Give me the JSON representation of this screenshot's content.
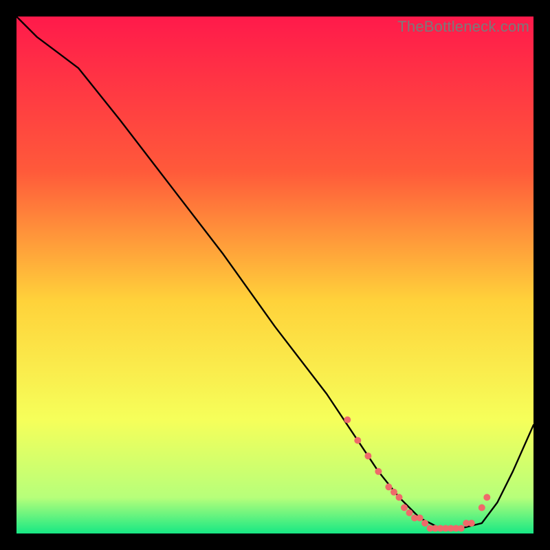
{
  "watermark": "TheBottleneck.com",
  "chart_data": {
    "type": "line",
    "title": "",
    "xlabel": "",
    "ylabel": "",
    "xlim": [
      0,
      100
    ],
    "ylim": [
      0,
      100
    ],
    "grid": false,
    "legend": false,
    "gradient_stops": [
      {
        "offset": 0,
        "color": "#ff1a4b"
      },
      {
        "offset": 0.3,
        "color": "#ff5a3a"
      },
      {
        "offset": 0.55,
        "color": "#ffd23a"
      },
      {
        "offset": 0.78,
        "color": "#f6ff5a"
      },
      {
        "offset": 0.93,
        "color": "#b7ff7a"
      },
      {
        "offset": 1.0,
        "color": "#17e884"
      }
    ],
    "series": [
      {
        "name": "bottleneck-curve",
        "x": [
          0,
          4,
          8,
          12,
          20,
          30,
          40,
          50,
          60,
          66,
          70,
          74,
          78,
          82,
          86,
          90,
          93,
          96,
          100
        ],
        "y": [
          100,
          96,
          93,
          90,
          80,
          67,
          54,
          40,
          27,
          18,
          12,
          7,
          3,
          1,
          1,
          2,
          6,
          12,
          21
        ]
      }
    ],
    "markers": {
      "name": "highlight-dots",
      "color": "#ef6a6a",
      "radius": 5,
      "x": [
        64,
        66,
        68,
        70,
        72,
        73,
        74,
        75,
        76,
        77,
        78,
        79,
        80,
        81,
        82,
        83,
        84,
        85,
        86,
        87,
        88,
        90,
        91
      ],
      "y": [
        22,
        18,
        15,
        12,
        9,
        8,
        7,
        5,
        4,
        3,
        3,
        2,
        1,
        1,
        1,
        1,
        1,
        1,
        1,
        2,
        2,
        5,
        7
      ]
    }
  }
}
